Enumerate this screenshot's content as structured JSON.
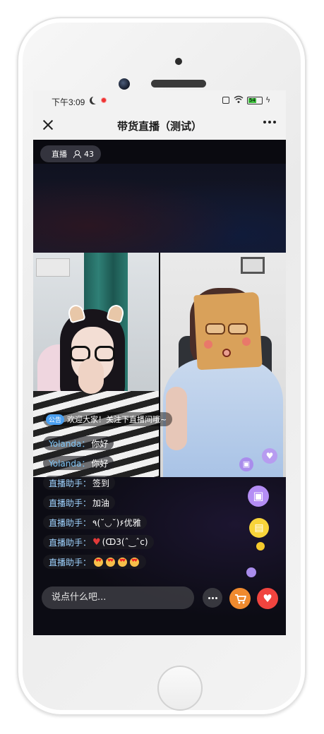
{
  "status_bar": {
    "time": "下午3:09",
    "battery": "54"
  },
  "nav": {
    "title": "带货直播（测试）"
  },
  "live": {
    "label": "直播",
    "viewers": "43"
  },
  "announcement": {
    "tag": "公告",
    "text": "欢迎大家！关注下直播间哦~"
  },
  "chat": [
    {
      "user": "Yolanda：",
      "message": "你好"
    },
    {
      "user": "Yolanda：",
      "message": "你好"
    },
    {
      "user": "直播助手：",
      "message": "签到"
    },
    {
      "user": "直播助手：",
      "message": "加油"
    },
    {
      "user": "直播助手：",
      "message": "٩(˘◡˘)۶优雅"
    },
    {
      "user": "直播助手：",
      "message": "(ↀ3(ˆ‿ˆc)"
    },
    {
      "user": "直播助手：",
      "message": ""
    }
  ],
  "input": {
    "placeholder": "说点什么吧..."
  },
  "colors": {
    "accent_blue": "#4a9ff0",
    "cart_orange": "#f08a2e",
    "like_red": "#f0443f",
    "gift_purple": "#b48df5"
  },
  "icons": [
    "close-icon",
    "more-icon",
    "viewer-icon",
    "heart-icon",
    "gift-icon",
    "shopping-bag-icon",
    "cart-icon",
    "like-heart-icon"
  ]
}
